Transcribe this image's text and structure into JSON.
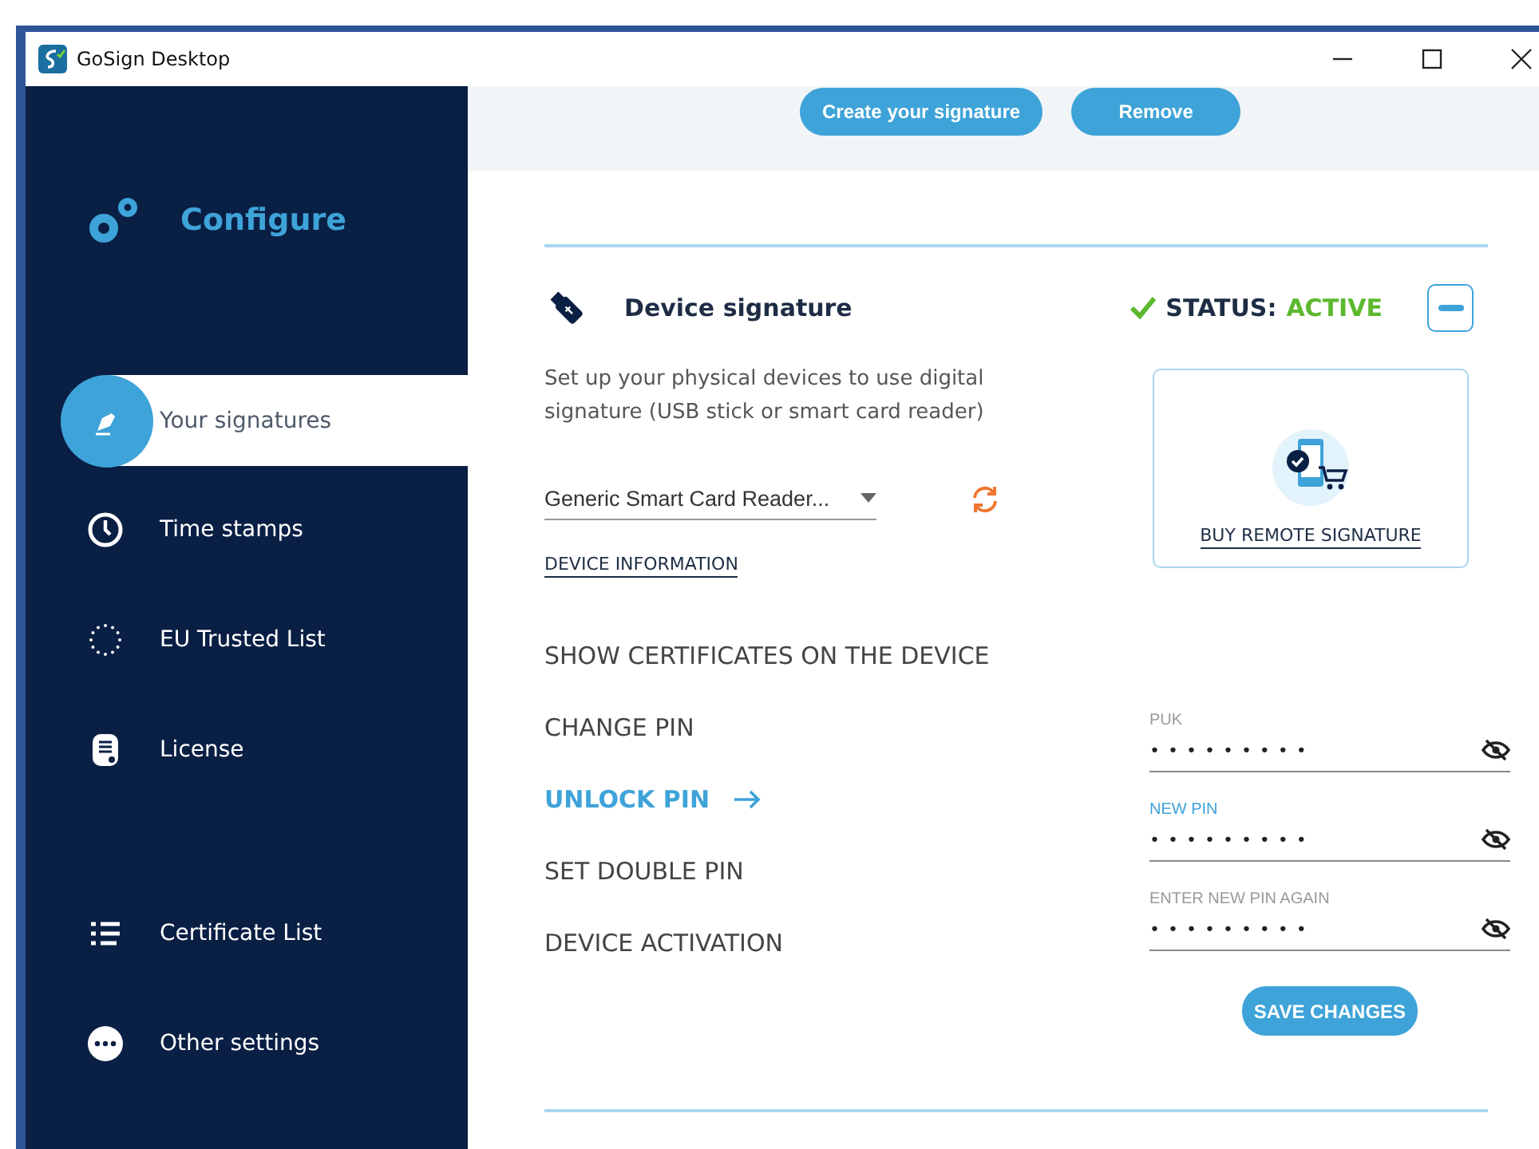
{
  "window": {
    "title": "GoSign Desktop"
  },
  "sidebar": {
    "heading": "Configure",
    "items": [
      {
        "label": "Your signatures",
        "selected": true
      },
      {
        "label": "Time stamps",
        "selected": false
      },
      {
        "label": "EU Trusted List",
        "selected": false
      },
      {
        "label": "License",
        "selected": false
      }
    ],
    "bottom_items": [
      {
        "label": "Certificate List",
        "selected": false
      },
      {
        "label": "Other settings",
        "selected": false
      }
    ]
  },
  "top_buttons": [
    "Create your signature",
    "Remove"
  ],
  "section": {
    "title": "Device signature",
    "status_label": "STATUS:",
    "status_value": "ACTIVE",
    "expanded": true,
    "description": "Set up your physical devices to use digital signature (USB stick or smart card reader)",
    "device_select": "Generic Smart Card Reader...",
    "device_information_link": "DEVICE INFORMATION",
    "buy_link": "BUY REMOTE SIGNATURE",
    "actions": [
      {
        "label": "SHOW CERTIFICATES ON THE DEVICE",
        "selected": false
      },
      {
        "label": "CHANGE PIN",
        "selected": false
      },
      {
        "label": "UNLOCK PIN",
        "selected": true
      },
      {
        "label": "SET DOUBLE PIN",
        "selected": false
      },
      {
        "label": "DEVICE ACTIVATION",
        "selected": false
      }
    ],
    "fields": [
      {
        "label": "PUK",
        "value": "•••••••••",
        "focused": false
      },
      {
        "label": "NEW PIN",
        "value": "•••••••••",
        "focused": true
      },
      {
        "label": "ENTER NEW PIN AGAIN",
        "value": "•••••••••",
        "focused": false
      }
    ],
    "save_button": "SAVE CHANGES"
  }
}
